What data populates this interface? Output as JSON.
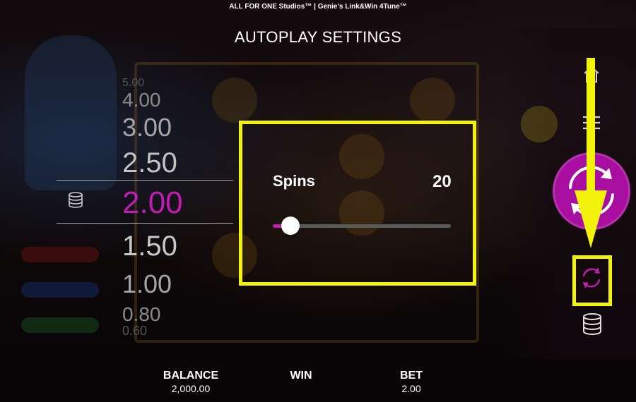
{
  "header": {
    "brand": "ALL FOR ONE Studios™ | Genie's Link&Win 4Tune™",
    "title": "AUTOPLAY SETTINGS"
  },
  "bet_selector": {
    "options": [
      "5.00",
      "4.00",
      "3.00",
      "2.50",
      "2.00",
      "1.50",
      "1.00",
      "0.80",
      "0.60"
    ],
    "selected": "2.00",
    "icon": "coin-stack-icon"
  },
  "spins": {
    "label": "Spins",
    "value": "20",
    "slider_fraction": 0.1
  },
  "controls": {
    "icons": [
      "home-icon",
      "menu-icon",
      "spin-icon",
      "autoplay-icon",
      "coin-stack-icon"
    ]
  },
  "footer": {
    "balance_label": "BALANCE",
    "balance_value": "2,000.00",
    "win_label": "WIN",
    "win_value": "",
    "bet_label": "BET",
    "bet_value": "2.00"
  },
  "colors": {
    "accent_magenta": "#c21cb4",
    "spin_button": "#a80ea0",
    "highlight_yellow": "#f2f20a"
  }
}
